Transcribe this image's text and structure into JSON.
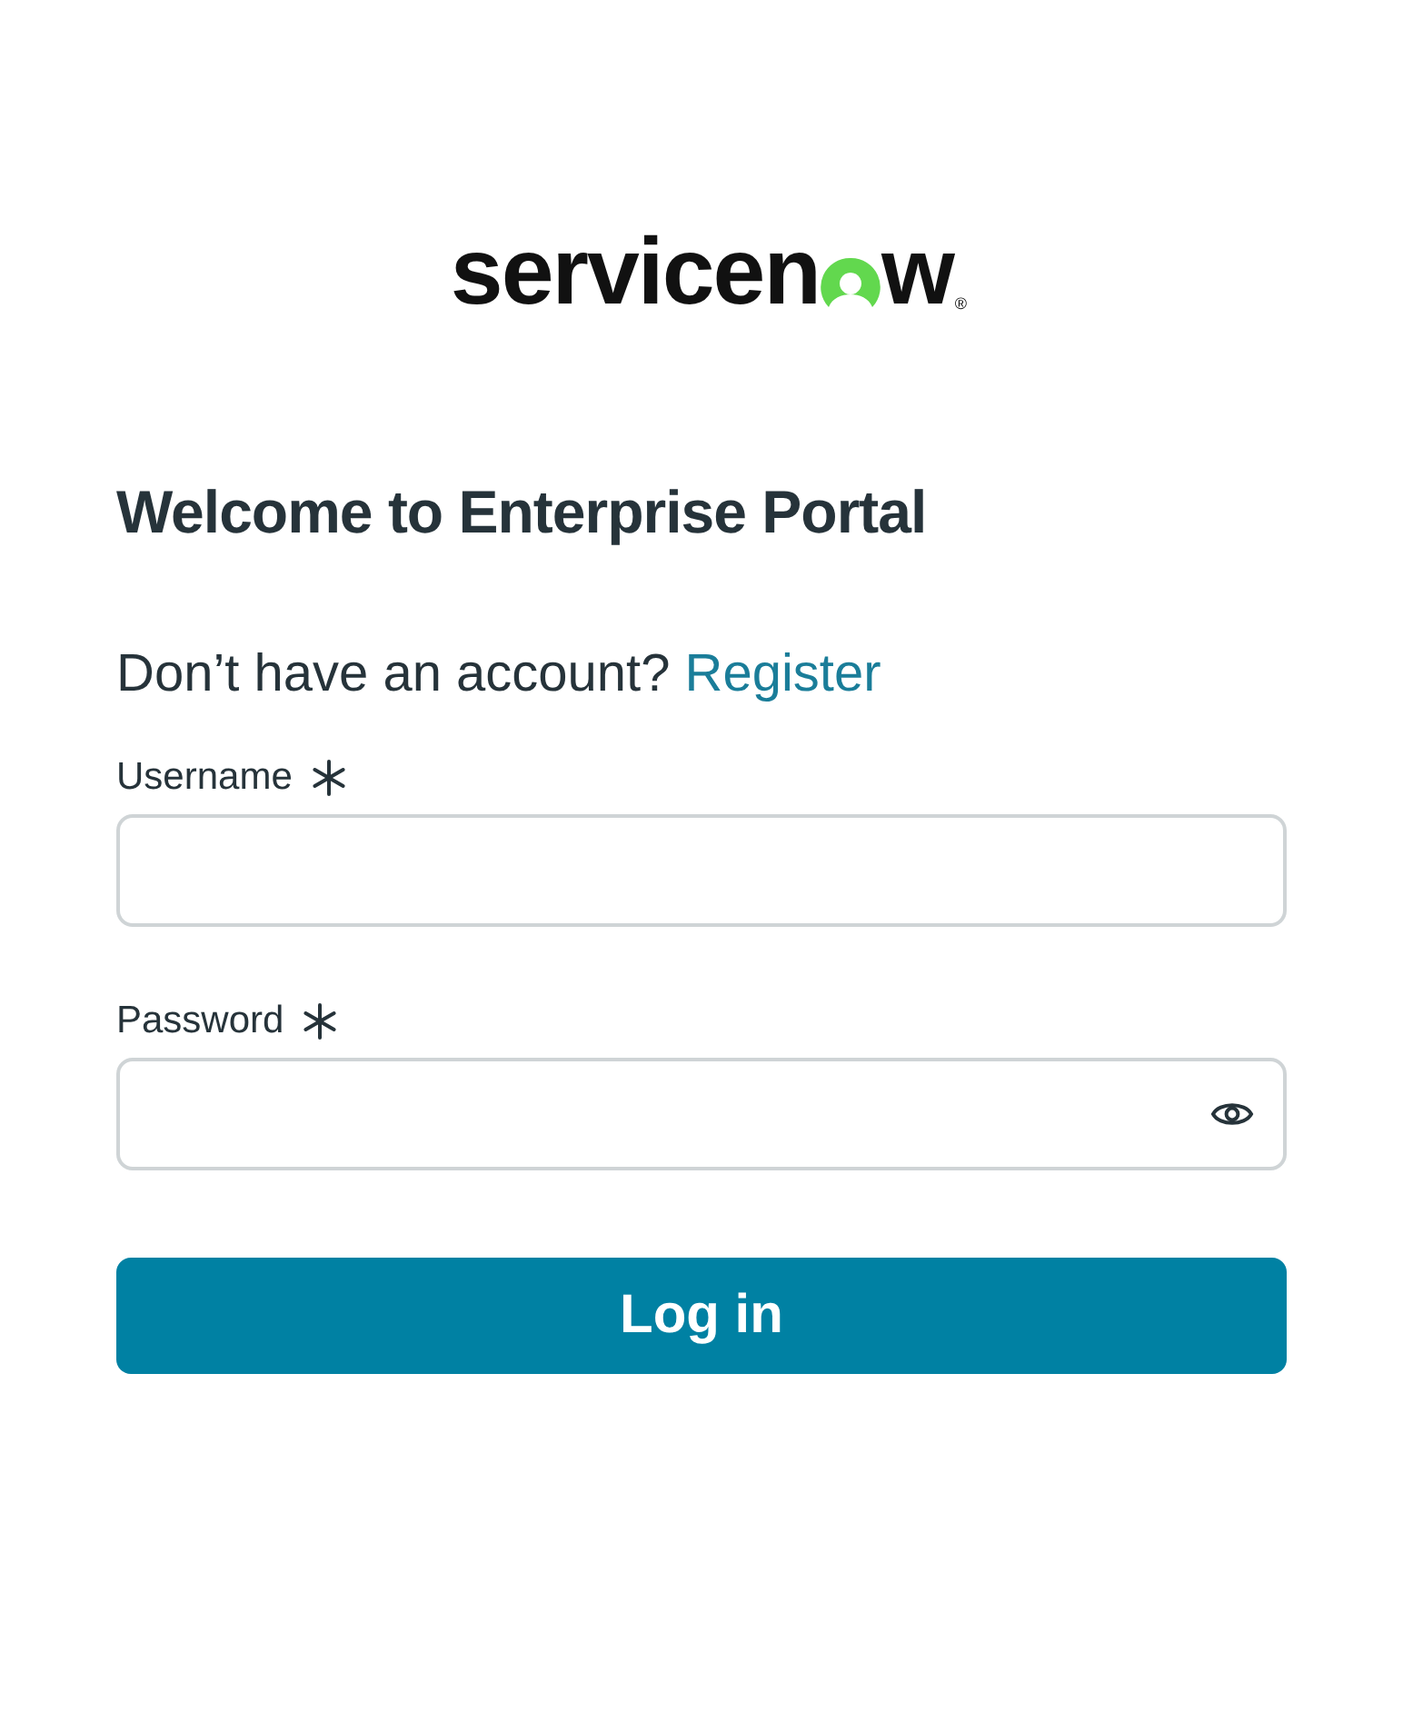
{
  "logo": {
    "text_start": "servicen",
    "text_end": "w",
    "registered": "®"
  },
  "title": "Welcome to Enterprise Portal",
  "register_prompt": {
    "text": "Don’t have an account?",
    "link": "Register"
  },
  "fields": [
    {
      "label": "Username",
      "required": true,
      "kind": "text"
    },
    {
      "label": "Password",
      "required": true,
      "kind": "password"
    }
  ],
  "submit_button": "Log in"
}
